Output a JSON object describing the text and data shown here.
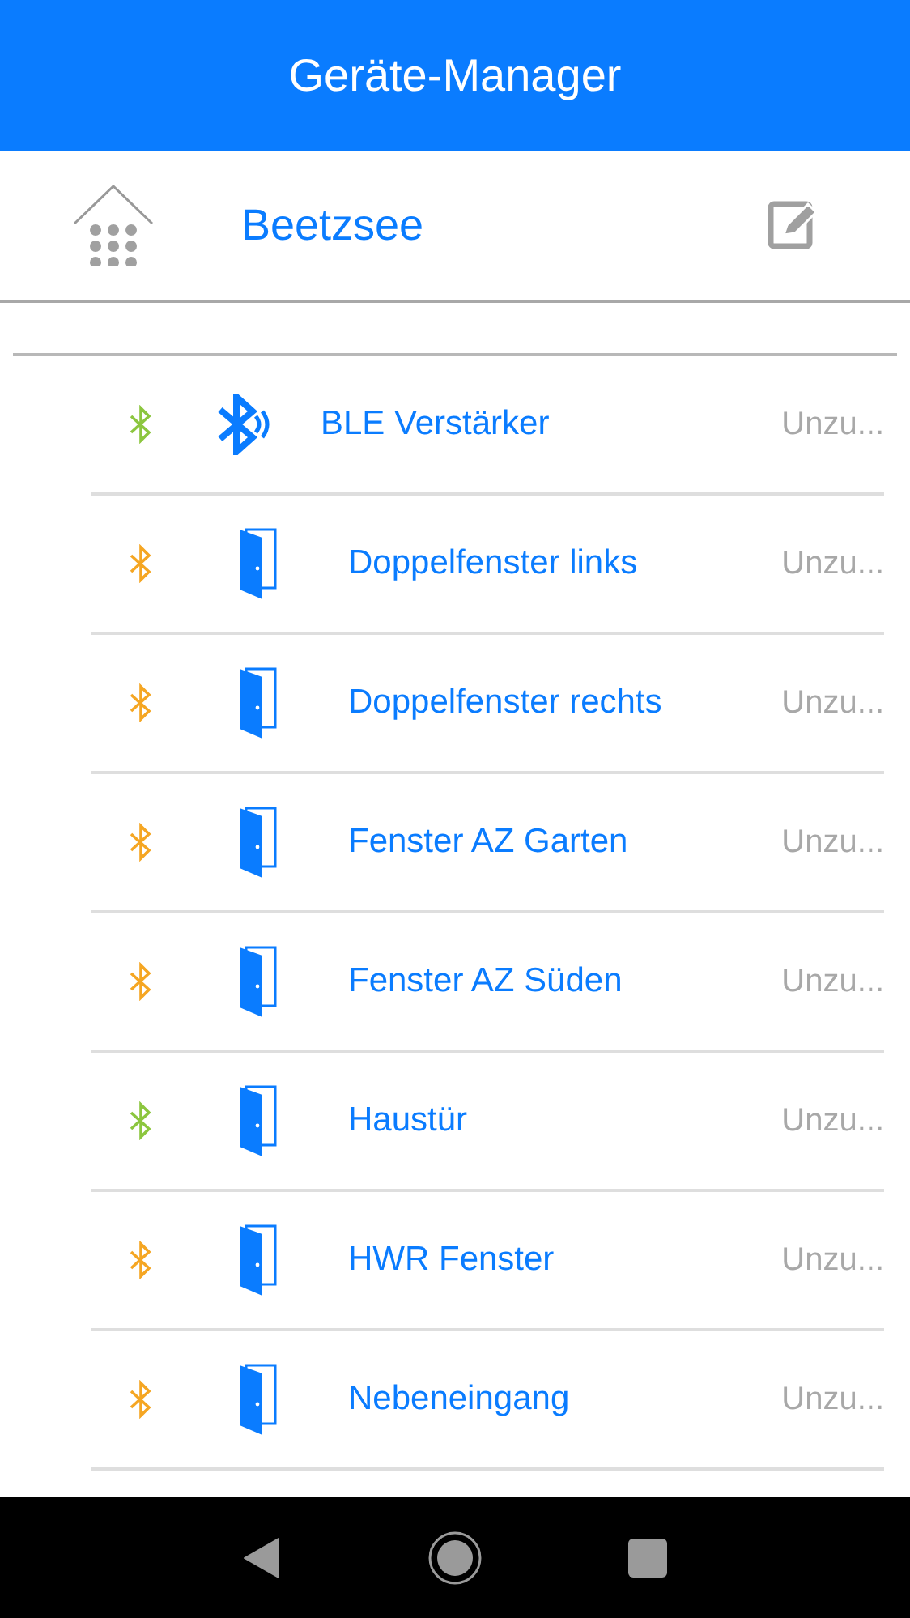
{
  "title": "Geräte-Manager",
  "location": "Beetzsee",
  "devices": [
    {
      "name": "BLE Verstärker",
      "kind": "ble",
      "status": "Unzu...",
      "color": "#8cc63f"
    },
    {
      "name": "Doppelfenster links",
      "kind": "door",
      "status": "Unzu...",
      "color": "#f5a623"
    },
    {
      "name": "Doppelfenster rechts",
      "kind": "door",
      "status": "Unzu...",
      "color": "#f5a623"
    },
    {
      "name": "Fenster AZ Garten",
      "kind": "door",
      "status": "Unzu...",
      "color": "#f5a623"
    },
    {
      "name": "Fenster AZ Süden",
      "kind": "door",
      "status": "Unzu...",
      "color": "#f5a623"
    },
    {
      "name": "Haustür",
      "kind": "door",
      "status": "Unzu...",
      "color": "#8cc63f"
    },
    {
      "name": "HWR Fenster",
      "kind": "door",
      "status": "Unzu...",
      "color": "#f5a623"
    },
    {
      "name": "Nebeneingang",
      "kind": "door",
      "status": "Unzu...",
      "color": "#f5a623"
    }
  ]
}
